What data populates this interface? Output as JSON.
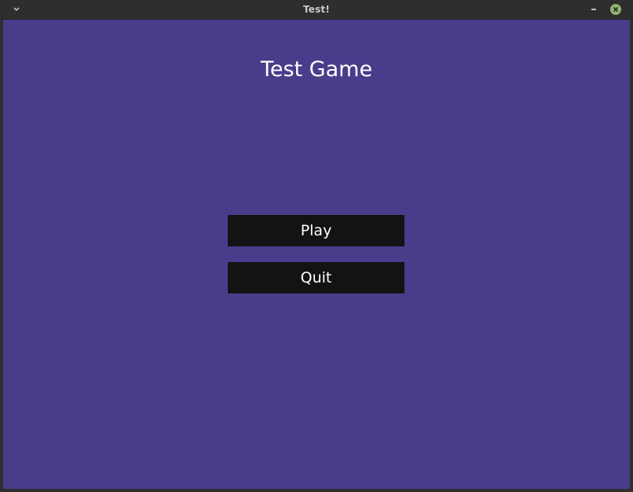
{
  "window": {
    "title": "Test!",
    "menu_icon": "chevron-down-icon",
    "minimize_icon": "minimize-icon",
    "close_icon": "close-icon",
    "close_color": "#8fb46f"
  },
  "game": {
    "background_color": "#483d8b",
    "title": "Test Game",
    "buttons": {
      "play_label": "Play",
      "quit_label": "Quit"
    },
    "button_color": "#141214"
  }
}
